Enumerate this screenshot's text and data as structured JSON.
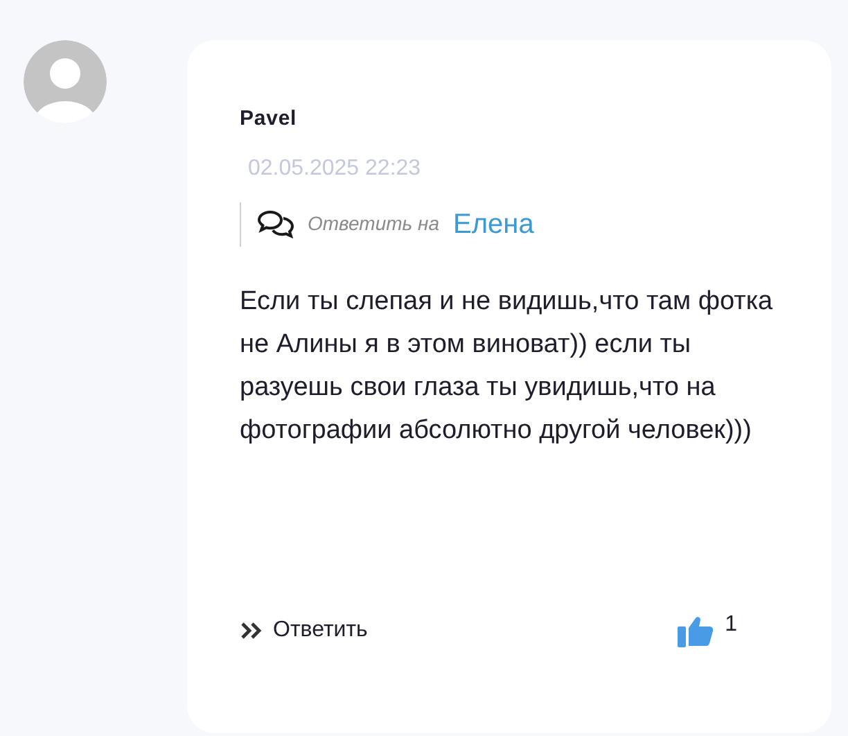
{
  "comment": {
    "author": "Pavel",
    "date": "02.05.2025 22:23",
    "reply_to_label": "Ответить на",
    "reply_to_name": "Елена",
    "text": "Если ты слепая и не видишь,что там фотка не Алины я в этом виноват)) если ты разуешь свои глаза ты увидишь,что на фотографии абсолютно другой человек)))",
    "reply_button": "Ответить",
    "likes": "1"
  }
}
